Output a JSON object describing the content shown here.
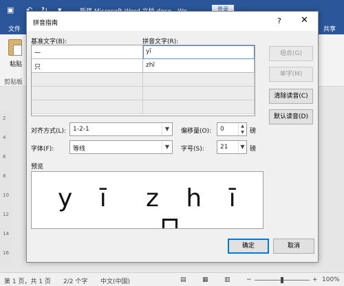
{
  "word": {
    "doc_title": "新建 Microsoft Word 文档.docx - Wo...",
    "login_label": "登录",
    "tab_file": "文件",
    "tab_share": "共享",
    "paste_label": "粘贴",
    "clipboard_label": "剪贴板",
    "ruler_marks": [
      "2",
      "4",
      "6",
      "8",
      "10",
      "12",
      "14",
      "16"
    ],
    "status": {
      "page": "第 1 页，共 1 页",
      "words": "2/2 个字",
      "language": "中文(中国)",
      "zoom": "100%"
    },
    "zoom_level": 1.0
  },
  "dialog": {
    "title": "拼音指南",
    "help_label": "?",
    "close_label": "✕",
    "base_text_label": "基准文字(B):",
    "ruby_text_label": "拼音文字(R):",
    "rows": [
      {
        "base": "一",
        "ruby": "yī"
      },
      {
        "base": "只",
        "ruby": "zhī"
      },
      {
        "base": "",
        "ruby": ""
      },
      {
        "base": "",
        "ruby": ""
      },
      {
        "base": "",
        "ruby": ""
      }
    ],
    "buttons": {
      "group": "组合(G)",
      "mono": "单字(M)",
      "clear": "清除读音(C)",
      "default": "默认读音(D)",
      "ok": "确定",
      "cancel": "取消"
    },
    "alignment": {
      "label": "对齐方式(L):",
      "value": "1-2-1"
    },
    "offset": {
      "label": "偏移量(O):",
      "value": "0",
      "unit": "磅"
    },
    "font": {
      "label": "字体(F):",
      "value": "等线"
    },
    "size": {
      "label": "字号(S):",
      "value": "21",
      "unit": "磅"
    },
    "preview_label": "预览",
    "preview_ruby": [
      "y ī",
      "z h ī"
    ]
  }
}
